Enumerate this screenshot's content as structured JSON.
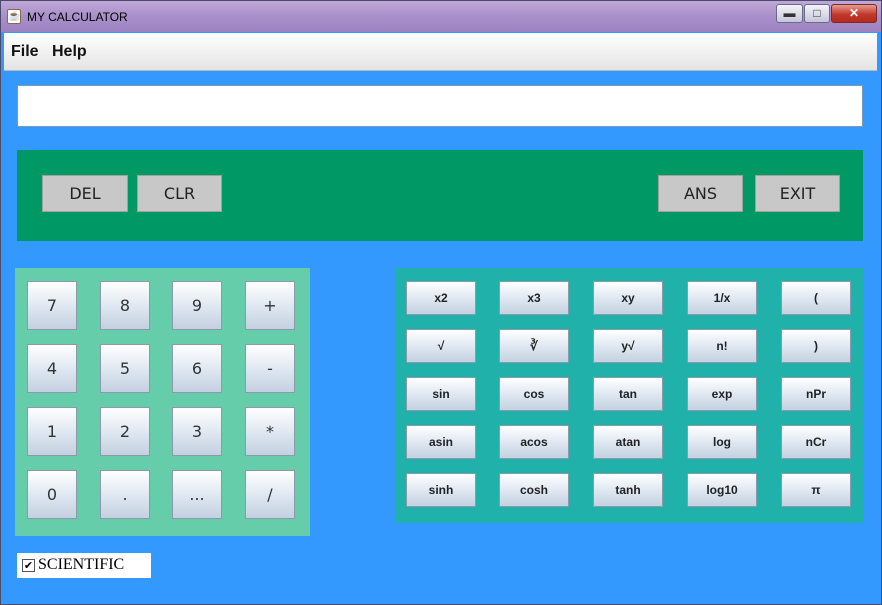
{
  "window": {
    "title": "MY CALCULATOR",
    "minimize": "▬",
    "maximize": "□",
    "close": "✕",
    "icon": "java-cup-icon"
  },
  "menu": {
    "file": "File",
    "help": "Help"
  },
  "display": {
    "value": ""
  },
  "top_buttons": {
    "del": "DEL",
    "clr": "CLR",
    "ans": "ANS",
    "exit": "EXIT"
  },
  "numpad": {
    "keys": [
      "7",
      "8",
      "9",
      "+",
      "4",
      "5",
      "6",
      "-",
      "1",
      "2",
      "3",
      "*",
      "0",
      ".",
      "...",
      "/"
    ]
  },
  "scientific": {
    "keys": [
      "x2",
      "x3",
      "xy",
      "1/x",
      "(",
      "√",
      "∛",
      "y√",
      "n!",
      ")",
      "sin",
      "cos",
      "tan",
      "exp",
      "nPr",
      "asin",
      "acos",
      "atan",
      "log",
      "nCr",
      "sinh",
      "cosh",
      "tanh",
      "log10",
      "π"
    ]
  },
  "scientific_mode": {
    "label": "SCIENTIFIC",
    "checked": true,
    "mark": "✔"
  },
  "colors": {
    "background": "#3399ff",
    "top_panel": "#009966",
    "numpad": "#66cdaa",
    "scipad": "#20b2aa"
  }
}
